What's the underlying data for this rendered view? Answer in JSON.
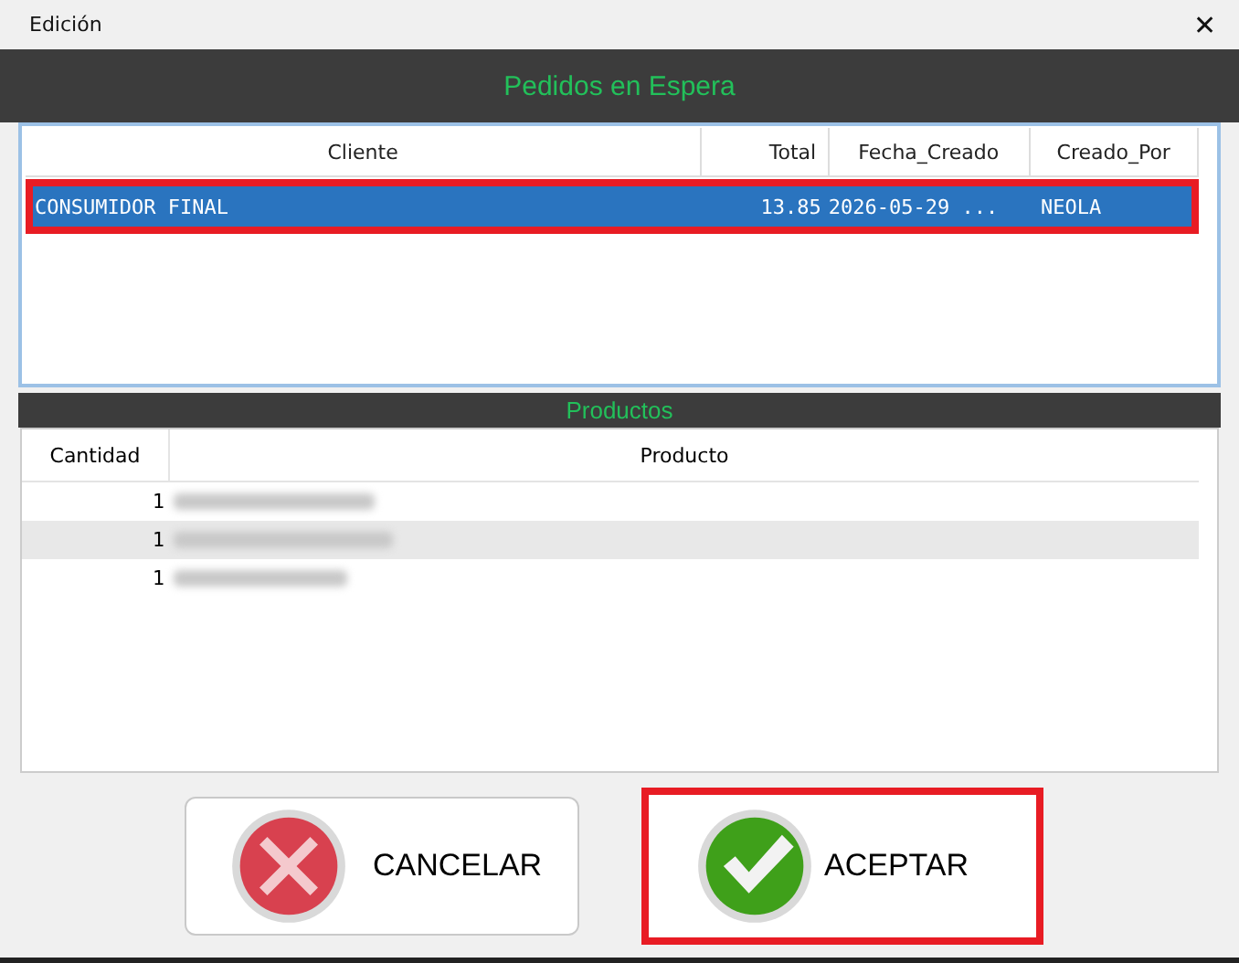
{
  "window": {
    "title": "Edición",
    "close": "✕"
  },
  "orders": {
    "title": "Pedidos en Espera",
    "columns": [
      "Cliente",
      "Total",
      "Fecha_Creado",
      "Creado_Por"
    ],
    "rows": [
      {
        "cells": [
          "CONSUMIDOR FINAL",
          "13.85",
          "2026-05-29 ...",
          "NEOLA"
        ],
        "selected": true,
        "highlighted": true
      }
    ]
  },
  "products": {
    "title": "Productos",
    "columns": [
      "Cantidad",
      "Producto"
    ],
    "rows": [
      {
        "quantity": "1",
        "name_blurred": true,
        "selected": false
      },
      {
        "quantity": "1",
        "name_blurred": true,
        "selected": true
      },
      {
        "quantity": "1",
        "name_blurred": true,
        "selected": false
      }
    ]
  },
  "buttons": [
    {
      "kind": "cancel",
      "label": "CANCELAR",
      "highlighted": false
    },
    {
      "kind": "accept",
      "label": "ACEPTAR",
      "highlighted": true
    }
  ]
}
